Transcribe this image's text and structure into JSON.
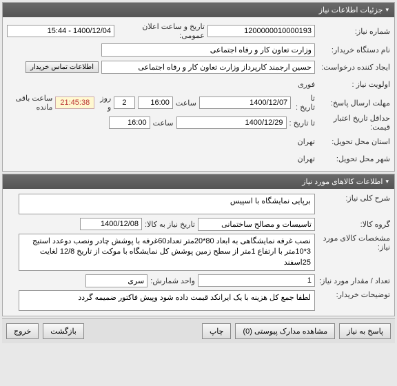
{
  "panel1": {
    "title": "جزئیات اطلاعات نیاز",
    "need_number_label": "شماره نیاز:",
    "need_number": "1200000010000193",
    "public_time_label": "تاریخ و ساعت اعلان عمومی:",
    "public_time": "1400/12/04 - 15:44",
    "buyer_label": "نام دستگاه خریدار:",
    "buyer": "وزارت تعاون کار و رفاه اجتماعی",
    "creator_label": "ایجاد کننده درخواست:",
    "creator": "حسین ارجمند کارپرداز وزارت تعاون کار و رفاه اجتماعی",
    "contact_btn": "اطلاعات تماس خریدار",
    "priority_label": "اولویت نیاز :",
    "priority": "فوری",
    "deadline_send_label": "مهلت ارسال پاسخ:",
    "to_date_label": "تا تاریخ :",
    "date1": "1400/12/07",
    "time_label": "ساعت",
    "time1": "16:00",
    "days_count": "2",
    "days_and": "روز و",
    "timer": "21:45:38",
    "timer_suffix": "ساعت باقی مانده",
    "min_valid_label": "حداقل تاریخ اعتبار قیمت:",
    "date2": "1400/12/29",
    "time2": "16:00",
    "province_label": "استان محل تحویل:",
    "province": "تهران",
    "city_label": "شهر محل تحویل:",
    "city": "تهران"
  },
  "panel2": {
    "title": "اطلاعات کالاهای مورد نیاز",
    "desc_label": "شرح کلی نیاز:",
    "desc": "برپایی نمایشگاه با اسپیس",
    "group_label": "گروه کالا:",
    "group": "تاسیسات و مصالح ساختمانی",
    "need_date_label": "تاریخ نیاز به کالا:",
    "need_date": "1400/12/08",
    "spec_label": "مشخصات کالای مورد نیاز:",
    "spec": "نصب غرفه نمایشگاهی به ابعاد 80*20متر تعداد60غرفه با پوشش چادر ونصب دوعدد استیج 3*10متر با ارتفاع 1متر از سطح زمین پوشش کل نمایشگاه با موکت از تاریخ 12/8 لغایت 25اسفند",
    "qty_label": "تعداد / مقدار مورد نیاز:",
    "qty": "1",
    "unit_label": "واحد شمارش:",
    "unit": "سری",
    "notes_label": "توضیحات خریدار:",
    "notes": "لطفا جمع کل هزینه با یک ایرانکد قیمت داده شود وپیش فاکتور ضمیمه گردد"
  },
  "footer": {
    "reply": "پاسخ به نیاز",
    "attach": "مشاهده مدارک پیوستی (0)",
    "print": "چاپ",
    "back": "بازگشت",
    "exit": "خروج"
  }
}
